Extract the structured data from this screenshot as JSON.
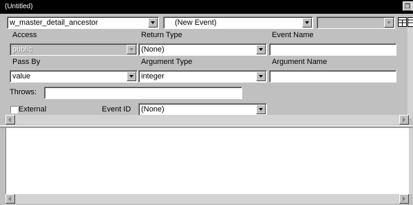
{
  "window": {
    "title": "(Untitled)"
  },
  "toolbar": {
    "object_select": "w_master_detail_ancestor",
    "event_select": "(New Event)",
    "third_select": ""
  },
  "form": {
    "access_label": "Access",
    "access_value": "public",
    "return_type_label": "Return Type",
    "return_type_value": "(None)",
    "event_name_label": "Event Name",
    "event_name_value": "",
    "pass_by_label": "Pass By",
    "pass_by_value": "value",
    "argument_type_label": "Argument Type",
    "argument_type_value": "integer",
    "argument_name_label": "Argument Name",
    "argument_name_value": "",
    "throws_label": "Throws:",
    "throws_value": "",
    "external_label": "External",
    "external_checked": false,
    "event_id_label": "Event ID",
    "event_id_value": "(None)"
  },
  "editor": {
    "content": ""
  },
  "icons": {
    "restore": "restore-icon",
    "close": "close-icon",
    "view1": "grid-view-icon",
    "view2": "list-view-icon"
  },
  "colors": {
    "titlebar": "#000000",
    "face": "#c0c0c0",
    "editor_bg": "#ffffff"
  }
}
